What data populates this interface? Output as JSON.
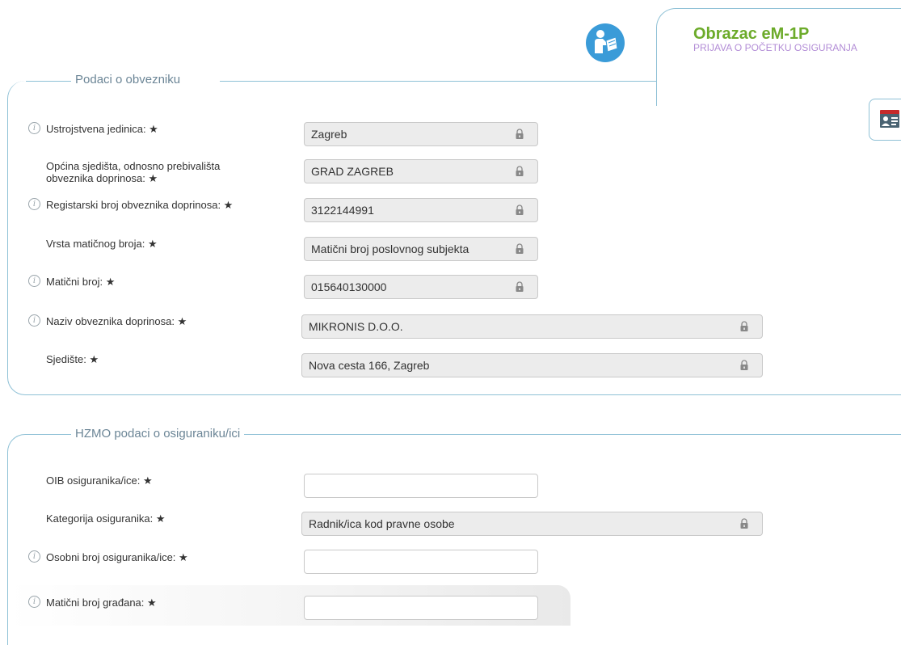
{
  "header": {
    "title": "Obrazac eM-1P",
    "subtitle": "PRIJAVA O POČETKU OSIGURANJA"
  },
  "sections": {
    "obveznik": {
      "legend": "Podaci o obvezniku",
      "fields": [
        {
          "label": "Ustrojstvena jedinica: ★",
          "value": "Zagreb",
          "locked": true,
          "info": true
        },
        {
          "label": "Općina sjedišta, odnosno prebivališta obveznika doprinosa: ★",
          "value": "GRAD ZAGREB",
          "locked": true,
          "info": false
        },
        {
          "label": "Registarski broj obveznika doprinosa: ★",
          "value": "3122144991",
          "locked": true,
          "info": true
        },
        {
          "label": "Vrsta matičnog broja: ★",
          "value": "Matični broj poslovnog subjekta",
          "locked": true,
          "info": false
        },
        {
          "label": "Matični broj: ★",
          "value": "015640130000",
          "locked": true,
          "info": true
        },
        {
          "label": "Naziv obveznika doprinosa: ★",
          "value": "MIKRONIS D.O.O.",
          "locked": true,
          "info": true
        },
        {
          "label": "Sjedište: ★",
          "value": "Nova cesta 166, Zagreb",
          "locked": true,
          "info": false
        }
      ]
    },
    "osiguranik": {
      "legend": "HZMO podaci o osiguraniku/ici",
      "fields": [
        {
          "label": "OIB osiguranika/ice: ★",
          "value": "",
          "locked": false,
          "info": false
        },
        {
          "label": "Kategorija osiguranika: ★",
          "value": "Radnik/ica kod pravne osobe",
          "locked": true,
          "info": false
        },
        {
          "label": "Osobni broj osiguranika/ice: ★",
          "value": "",
          "locked": false,
          "info": true
        },
        {
          "label": "Matični broj građana: ★",
          "value": "",
          "locked": false,
          "info": true
        }
      ]
    }
  },
  "icons": {
    "help": "help-manual-icon",
    "side": "id-card-icon",
    "info": "info-icon",
    "lock": "lock-icon"
  },
  "colors": {
    "title_green": "#6cab2a",
    "subtitle_purple": "#b28cd6",
    "border_blue": "#8fc1d6",
    "help_icon_blue": "#3a9bd8",
    "locked_bg": "#ececec"
  }
}
